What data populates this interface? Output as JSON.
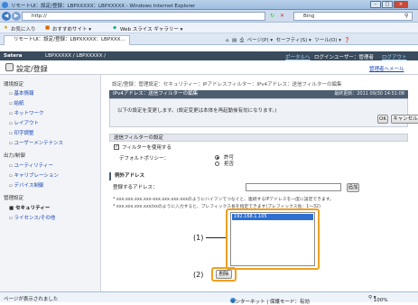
{
  "window": {
    "title": "リモートUI：設定/登録：LBPXXXXX：LBPXXXXX - Windows Internet Explorer",
    "min": "–",
    "max": "□",
    "close": "✕"
  },
  "browser": {
    "address": "http://",
    "search_text": "Bing",
    "favorites": "お気に入り",
    "recommended": "おすすめサイト ▾",
    "web_slice": "Web スライス ギャラリー ▾",
    "tab_label": "リモートUI：設定/登録：LBPXXXXX：LBPXXX...",
    "page_menu": "ページ(P) ▾",
    "safety_menu": "セーフティ(S) ▾",
    "tools_menu": "ツール(O) ▾",
    "help_icon": "❓"
  },
  "header": {
    "brand": "Satera",
    "printer": "LBPXXXXX / LBPXXXXX /",
    "portal_link": "ポータルへ",
    "login_user": "ログインユーザー：管理者",
    "logout_link": "ログアウト",
    "page_title": "設定/登録",
    "manager_mail": "管理者へメール"
  },
  "sidebar": {
    "sections": [
      {
        "label": "環境設定",
        "items": [
          "基本情報",
          "給紙",
          "ネットワーク",
          "レイアウト",
          "印字調整",
          "ユーザーメンテナンス"
        ]
      },
      {
        "label": "出力/制御",
        "items": [
          "ユーティリティー",
          "キャリブレーション",
          "デバイス制御"
        ]
      },
      {
        "label": "管理設定",
        "items": [
          "セキュリティー",
          "ライセンス/その他"
        ]
      }
    ],
    "active": "セキュリティー"
  },
  "main": {
    "breadcrumb": "設定/登録：管理設定：セキュリティー：IPアドレスフィルター：IPv4アドレス：送信フィルターの編集",
    "panel_title": "IPv4アドレス：送信フィルターの編集",
    "last_updated": "最終更新：2011 09/30 14:51:08",
    "notice": "以下の設定を変更します。(設定変更は本体を再起動後有効になります。)",
    "ok": "OK",
    "cancel": "キャンセル",
    "filter_section": "送信フィルターの設定",
    "use_filter": "フィルターを使用する",
    "default_policy": "デフォルトポリシー：",
    "policy_allow": "許可",
    "policy_deny": "拒否",
    "exception_section": "例外アドレス",
    "address_label": "登録するアドレス：",
    "add_button": "追加",
    "hint1": "* xxx.xxx.xxx.xxx-xxx.xxx.xxx.xxxのようにハイフンでつなぐと、連続するIPアドレスを一度に設定できます。",
    "hint2": "* xxx.xxx.xxx.xxx/xxのように入力すると、プレフィックス長を指定できます(プレフィックス長：1〜32)",
    "list_items": [
      "192.168.1.105"
    ],
    "delete_button": "削除",
    "callout1": "(1)",
    "callout2": "(2)"
  },
  "status": {
    "left": "ページが表示されました",
    "zone": "インターネット | 保護モード：有効",
    "zoom": "100%"
  }
}
